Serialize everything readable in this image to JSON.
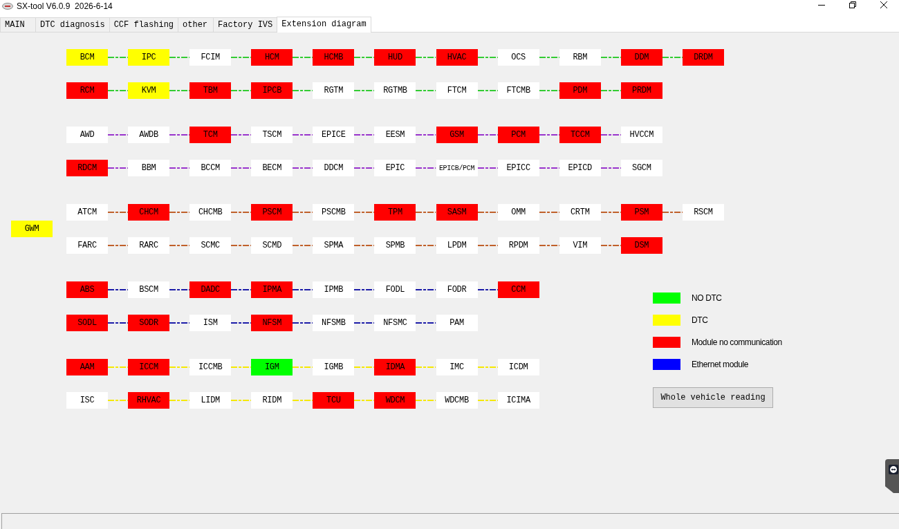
{
  "window": {
    "title": "SX-tool V6.0.9  2026-6-14"
  },
  "tabs": [
    {
      "label": "MAIN",
      "selected": false
    },
    {
      "label": "DTC diagnosis",
      "selected": false
    },
    {
      "label": "CCF flashing",
      "selected": false
    },
    {
      "label": "other",
      "selected": false
    },
    {
      "label": "Factory IVS",
      "selected": false
    },
    {
      "label": "Extension diagram",
      "selected": true
    }
  ],
  "gateway": {
    "label": "GWM",
    "color": "#ffff00"
  },
  "bus_groups": [
    {
      "color": "#33cc33",
      "rows": [
        [
          {
            "label": "BCM",
            "color": "#ffff00"
          },
          {
            "label": "IPC",
            "color": "#ffff00"
          },
          {
            "label": "FCIM",
            "color": "#ffffff"
          },
          {
            "label": "HCM",
            "color": "#ff0000"
          },
          {
            "label": "HCMB",
            "color": "#ff0000"
          },
          {
            "label": "HUD",
            "color": "#ff0000"
          },
          {
            "label": "HVAC",
            "color": "#ff0000"
          },
          {
            "label": "OCS",
            "color": "#ffffff"
          },
          {
            "label": "RBM",
            "color": "#ffffff"
          },
          {
            "label": "DDM",
            "color": "#ff0000"
          },
          {
            "label": "DRDM",
            "color": "#ff0000"
          }
        ],
        [
          {
            "label": "RCM",
            "color": "#ff0000"
          },
          {
            "label": "KVM",
            "color": "#ffff00"
          },
          {
            "label": "TBM",
            "color": "#ff0000"
          },
          {
            "label": "IPCB",
            "color": "#ff0000"
          },
          {
            "label": "RGTM",
            "color": "#ffffff"
          },
          {
            "label": "RGTMB",
            "color": "#ffffff"
          },
          {
            "label": "FTCM",
            "color": "#ffffff"
          },
          {
            "label": "FTCMB",
            "color": "#ffffff"
          },
          {
            "label": "PDM",
            "color": "#ff0000"
          },
          {
            "label": "PRDM",
            "color": "#ff0000"
          }
        ]
      ]
    },
    {
      "color": "#9933cc",
      "rows": [
        [
          {
            "label": "AWD",
            "color": "#ffffff"
          },
          {
            "label": "AWDB",
            "color": "#ffffff"
          },
          {
            "label": "TCM",
            "color": "#ff0000"
          },
          {
            "label": "TSCM",
            "color": "#ffffff"
          },
          {
            "label": "EPICE",
            "color": "#ffffff"
          },
          {
            "label": "EESM",
            "color": "#ffffff"
          },
          {
            "label": "GSM",
            "color": "#ff0000"
          },
          {
            "label": "PCM",
            "color": "#ff0000"
          },
          {
            "label": "TCCM",
            "color": "#ff0000"
          },
          {
            "label": "HVCCM",
            "color": "#ffffff"
          }
        ],
        [
          {
            "label": "RDCM",
            "color": "#ff0000"
          },
          {
            "label": "BBM",
            "color": "#ffffff"
          },
          {
            "label": "BCCM",
            "color": "#ffffff"
          },
          {
            "label": "BECM",
            "color": "#ffffff"
          },
          {
            "label": "DDCM",
            "color": "#ffffff"
          },
          {
            "label": "EPIC",
            "color": "#ffffff"
          },
          {
            "label": "EPICB/PCM",
            "color": "#ffffff"
          },
          {
            "label": "EPICC",
            "color": "#ffffff"
          },
          {
            "label": "EPICD",
            "color": "#ffffff"
          },
          {
            "label": "SGCM",
            "color": "#ffffff"
          }
        ]
      ]
    },
    {
      "color": "#c0602a",
      "rows": [
        [
          {
            "label": "ATCM",
            "color": "#ffffff"
          },
          {
            "label": "CHCM",
            "color": "#ff0000"
          },
          {
            "label": "CHCMB",
            "color": "#ffffff"
          },
          {
            "label": "PSCM",
            "color": "#ff0000"
          },
          {
            "label": "PSCMB",
            "color": "#ffffff"
          },
          {
            "label": "TPM",
            "color": "#ff0000"
          },
          {
            "label": "SASM",
            "color": "#ff0000"
          },
          {
            "label": "OMM",
            "color": "#ffffff"
          },
          {
            "label": "CRTM",
            "color": "#ffffff"
          },
          {
            "label": "PSM",
            "color": "#ff0000"
          },
          {
            "label": "RSCM",
            "color": "#ffffff"
          }
        ],
        [
          {
            "label": "FARC",
            "color": "#ffffff"
          },
          {
            "label": "RARC",
            "color": "#ffffff"
          },
          {
            "label": "SCMC",
            "color": "#ffffff"
          },
          {
            "label": "SCMD",
            "color": "#ffffff"
          },
          {
            "label": "SPMA",
            "color": "#ffffff"
          },
          {
            "label": "SPMB",
            "color": "#ffffff"
          },
          {
            "label": "LPDM",
            "color": "#ffffff"
          },
          {
            "label": "RPDM",
            "color": "#ffffff"
          },
          {
            "label": "VIM",
            "color": "#ffffff"
          },
          {
            "label": "DSM",
            "color": "#ff0000"
          }
        ]
      ]
    },
    {
      "color": "#1c1ca8",
      "rows": [
        [
          {
            "label": "ABS",
            "color": "#ff0000"
          },
          {
            "label": "BSCM",
            "color": "#ffffff"
          },
          {
            "label": "DADC",
            "color": "#ff0000"
          },
          {
            "label": "IPMA",
            "color": "#ff0000"
          },
          {
            "label": "IPMB",
            "color": "#ffffff"
          },
          {
            "label": "FODL",
            "color": "#ffffff"
          },
          {
            "label": "FODR",
            "color": "#ffffff"
          },
          {
            "label": "CCM",
            "color": "#ff0000"
          }
        ],
        [
          {
            "label": "SODL",
            "color": "#ff0000"
          },
          {
            "label": "SODR",
            "color": "#ff0000"
          },
          {
            "label": "ISM",
            "color": "#ffffff"
          },
          {
            "label": "NFSM",
            "color": "#ff0000"
          },
          {
            "label": "NFSMB",
            "color": "#ffffff"
          },
          {
            "label": "NFSMC",
            "color": "#ffffff"
          },
          {
            "label": "PAM",
            "color": "#ffffff"
          }
        ]
      ]
    },
    {
      "color": "#f5e800",
      "rows": [
        [
          {
            "label": "AAM",
            "color": "#ff0000"
          },
          {
            "label": "ICCM",
            "color": "#ff0000"
          },
          {
            "label": "ICCMB",
            "color": "#ffffff"
          },
          {
            "label": "IGM",
            "color": "#00ff00"
          },
          {
            "label": "IGMB",
            "color": "#ffffff"
          },
          {
            "label": "IDMA",
            "color": "#ff0000"
          },
          {
            "label": "IMC",
            "color": "#ffffff"
          },
          {
            "label": "ICDM",
            "color": "#ffffff"
          }
        ],
        [
          {
            "label": "ISC",
            "color": "#ffffff"
          },
          {
            "label": "RHVAC",
            "color": "#ff0000"
          },
          {
            "label": "LIDM",
            "color": "#ffffff"
          },
          {
            "label": "RIDM",
            "color": "#ffffff"
          },
          {
            "label": "TCU",
            "color": "#ff0000"
          },
          {
            "label": "WDCM",
            "color": "#ff0000"
          },
          {
            "label": "WDCMB",
            "color": "#ffffff"
          },
          {
            "label": "ICIMA",
            "color": "#ffffff"
          }
        ]
      ]
    }
  ],
  "legend": [
    {
      "color": "#00ff00",
      "label": "NO DTC"
    },
    {
      "color": "#ffff00",
      "label": "DTC"
    },
    {
      "color": "#ff0000",
      "label": "Module no communication"
    },
    {
      "color": "#0000ff",
      "label": "Ethernet module"
    }
  ],
  "read_button": {
    "label": "Whole vehicle reading"
  }
}
